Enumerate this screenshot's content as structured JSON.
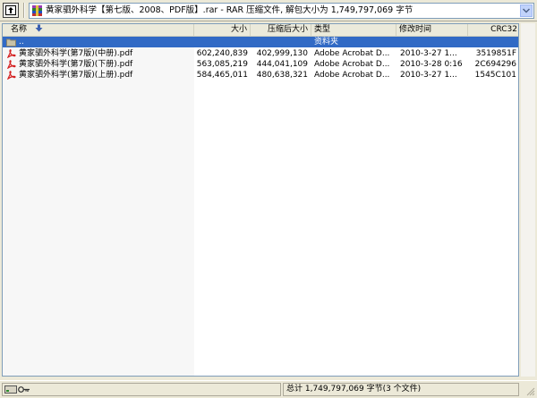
{
  "toolbar": {
    "path": "黄家驷外科学【第七版、2008、PDF版】.rar - RAR 压缩文件, 解包大小为 1,749,797,069 字节"
  },
  "columns": {
    "name": "名称",
    "size": "大小",
    "packed": "压缩后大小",
    "type": "类型",
    "modified": "修改时间",
    "crc": "CRC32"
  },
  "folder_row": {
    "name": "..",
    "type": "资料夹"
  },
  "files": [
    {
      "name": "黄家驷外科学(第7版)(中册).pdf",
      "size": "602,240,839",
      "packed": "402,999,130",
      "type": "Adobe Acrobat D...",
      "modified": "2010-3-27 1...",
      "crc": "3519851F"
    },
    {
      "name": "黄家驷外科学(第7版)(下册).pdf",
      "size": "563,085,219",
      "packed": "444,041,109",
      "type": "Adobe Acrobat D...",
      "modified": "2010-3-28 0:16",
      "crc": "2C694296"
    },
    {
      "name": "黄家驷外科学(第7版)(上册).pdf",
      "size": "584,465,011",
      "packed": "480,638,321",
      "type": "Adobe Acrobat D...",
      "modified": "2010-3-27 1...",
      "crc": "1545C101"
    }
  ],
  "status": {
    "summary": "总计 1,749,797,069 字节(3 个文件)"
  },
  "colors": {
    "selection": "#316ac5",
    "pdf_red": "#d42020"
  }
}
